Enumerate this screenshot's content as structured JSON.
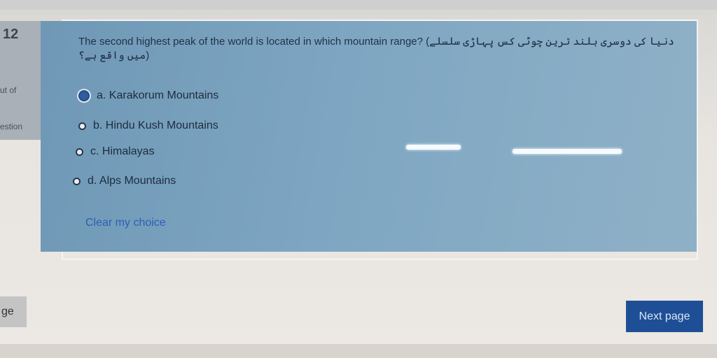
{
  "sidebar": {
    "question_number": "12",
    "out_of_label": "ut of",
    "question_label": "estion"
  },
  "question": {
    "text": "The second highest peak of the world is located in which mountain range? (دنیا کی دوسری بلند ترین چوٹی کس پہاڑی سلسلے میں واقع ہے؟)"
  },
  "options": [
    {
      "label": "a. Karakorum Mountains",
      "selected": true
    },
    {
      "label": "b. Hindu Kush Mountains",
      "selected": false
    },
    {
      "label": "c. Himalayas",
      "selected": false
    },
    {
      "label": "d. Alps Mountains",
      "selected": false
    }
  ],
  "clear_choice_label": "Clear my choice",
  "nav": {
    "previous_label": "ge",
    "next_label": "Next page"
  },
  "colors": {
    "card": "#7ea6c2",
    "next_button": "#1e4f96",
    "link": "#2c5eb8"
  }
}
